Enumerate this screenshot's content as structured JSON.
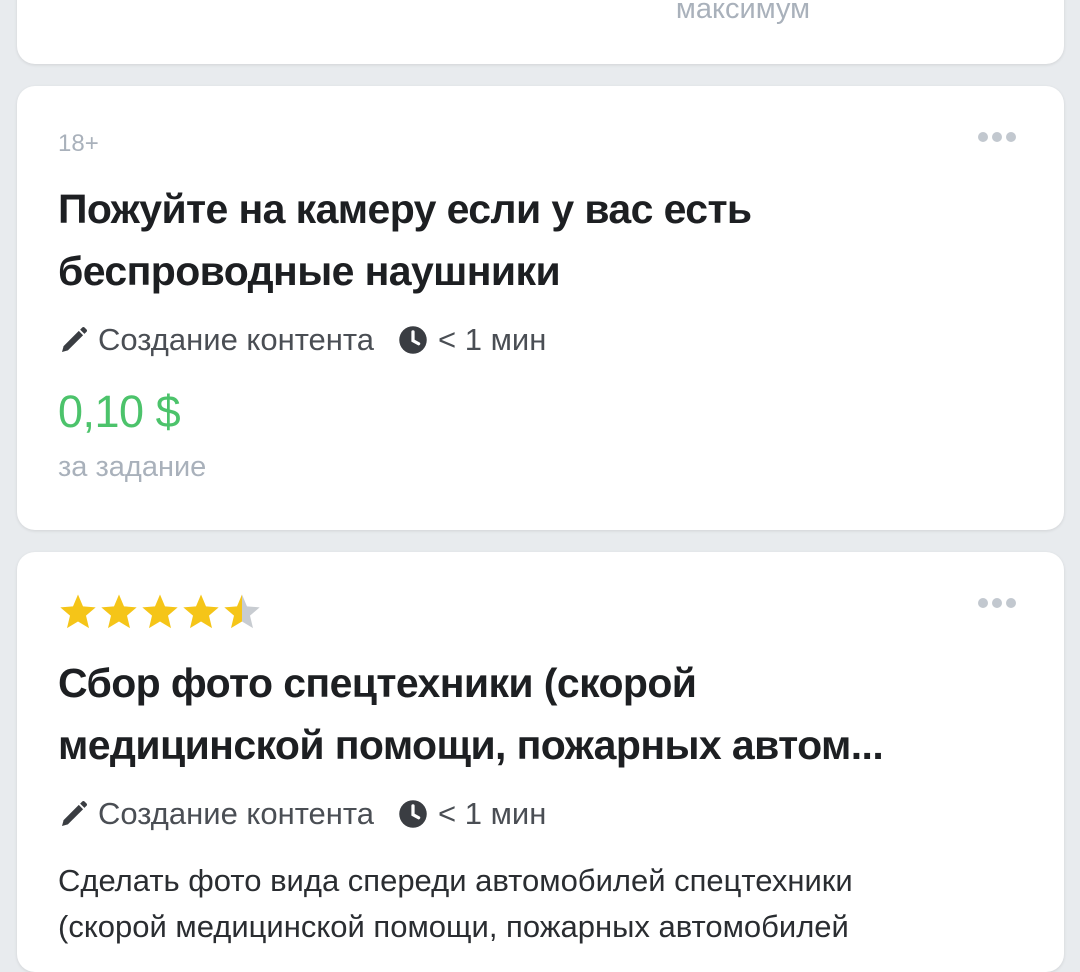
{
  "top_card": {
    "max_label": "максимум"
  },
  "tasks": [
    {
      "age_badge": "18+",
      "title_line1": "Пожуйте на камеру если у вас есть",
      "title_line2": "беспроводные наушники",
      "category": "Создание контента",
      "duration": "< 1 мин",
      "price": "0,10 $",
      "price_note": "за задание",
      "more_icon": "more-dots-icon",
      "category_icon": "pencil-icon",
      "duration_icon": "clock-icon"
    },
    {
      "rating": 4.5,
      "rating_max": 5,
      "title_line1": "Сбор фото спецтехники (скорой",
      "title_line2": "медицинской помощи, пожарных автом...",
      "category": "Создание контента",
      "duration": "< 1 мин",
      "description_line1": "Сделать фото вида спереди автомобилей спецтехники",
      "description_line2": "(скорой медицинской помощи, пожарных автомобилей",
      "more_icon": "more-dots-icon",
      "category_icon": "pencil-icon",
      "duration_icon": "clock-icon"
    }
  ],
  "colors": {
    "background": "#e8ebee",
    "card": "#ffffff",
    "price": "#4cc36b",
    "star": "#f5c518",
    "star_empty": "#c8ccd1",
    "muted": "#a9b1bb"
  }
}
